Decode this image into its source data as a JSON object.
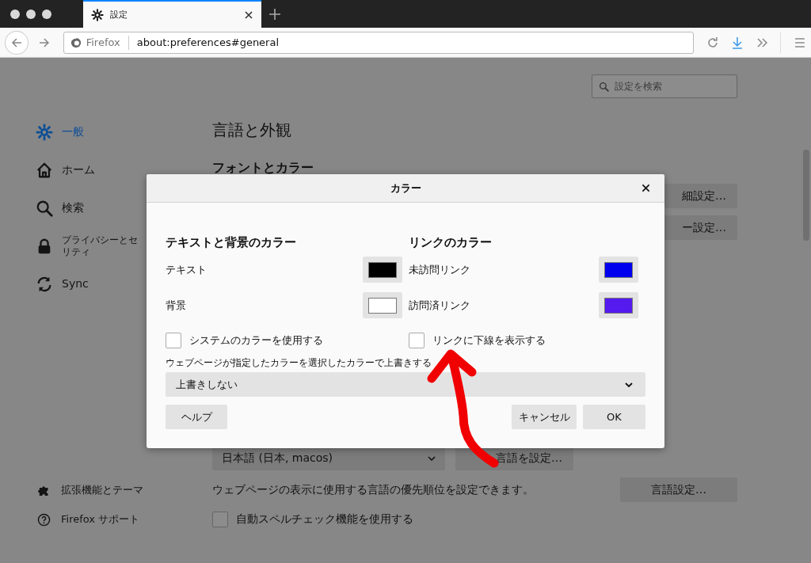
{
  "browser": {
    "tab": {
      "title": "設定",
      "selected": true
    },
    "identity": "Firefox",
    "url": "about:preferences#general"
  },
  "sidebar": {
    "items": [
      {
        "label": "一般",
        "selected": true
      },
      {
        "label": "ホーム",
        "selected": false
      },
      {
        "label": "検索",
        "selected": false
      },
      {
        "label": "プライバシーとセリティ",
        "selected": false
      },
      {
        "label": "Sync",
        "selected": false
      }
    ],
    "footer": [
      {
        "label": "拡張機能とテーマ"
      },
      {
        "label": "Firefox サポート"
      }
    ]
  },
  "content": {
    "search": {
      "placeholder": "設定を検索"
    },
    "heading": "言語と外観",
    "subheading": "フォントとカラー",
    "buttons_top": [
      "細設定…",
      "ー設定…"
    ],
    "language_select": "日本語 (日本, macos)",
    "alt_language_button": "言語を設定…",
    "language_text": "ウェブページの表示に使用する言語の優先順位を設定できます。",
    "language_button": "言語設定…",
    "spellcheck": {
      "label": "自動スペルチェック機能を使用する",
      "checked": false
    }
  },
  "dialog": {
    "title": "カラー",
    "columns": [
      {
        "heading": "テキストと背景のカラー",
        "swatches": [
          {
            "label": "テキスト",
            "color": "#000000"
          },
          {
            "label": "背景",
            "color": "#ffffff"
          }
        ],
        "checkbox": {
          "label": "システムのカラーを使用する",
          "checked": false
        }
      },
      {
        "heading": "リンクのカラー",
        "swatches": [
          {
            "label": "未訪問リンク",
            "color": "#0000ee"
          },
          {
            "label": "訪問済リンク",
            "color": "#551aee"
          }
        ],
        "checkbox": {
          "label": "リンクに下線を表示する",
          "checked": false
        }
      }
    ],
    "override_label": "ウェブページが指定したカラーを選択したカラーで上書きする",
    "override_value": "上書きしない",
    "help_button": "ヘルプ",
    "cancel_button": "キャンセル",
    "ok_button": "OK"
  }
}
